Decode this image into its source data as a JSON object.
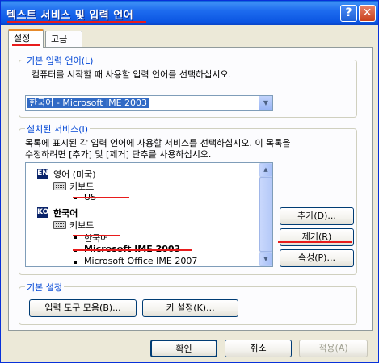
{
  "window": {
    "title": "텍스트 서비스 및 입력 언어",
    "help_glyph": "?",
    "close_glyph": "✕"
  },
  "tabs": [
    {
      "label": "설정",
      "active": true
    },
    {
      "label": "고급",
      "active": false
    }
  ],
  "default_language": {
    "legend": "기본 입력 언어(L)",
    "description": "컴퓨터를 시작할 때 사용할 입력 언어를 선택하십시오.",
    "selected": "한국어 - Microsoft IME 2003"
  },
  "installed_services": {
    "legend": "설치된 서비스(I)",
    "description_line1": "목록에 표시된 각 입력 언어에 사용할 서비스를 선택하십시오. 이 목록을",
    "description_line2": "수정하려면 [추가] 및 [제거] 단추를 사용하십시오.",
    "items": {
      "en_badge": "EN",
      "en_language": "영어 (미국)",
      "en_keyboard": "키보드",
      "en_layout": "US",
      "ko_badge": "KO",
      "ko_language": "한국어",
      "ko_keyboard": "키보드",
      "ko_layout": "한국어",
      "ko_ime_2003": "Microsoft IME 2003",
      "ko_ime_2007": "Microsoft Office IME 2007"
    },
    "buttons": {
      "add": "추가(D)...",
      "remove": "제거(R)",
      "properties": "속성(P)..."
    }
  },
  "preferences": {
    "legend": "기본 설정",
    "language_bar_button": "입력 도구 모음(B)...",
    "key_settings_button": "키 설정(K)..."
  },
  "footer": {
    "ok": "확인",
    "cancel": "취소",
    "apply": "적용(A)"
  },
  "colors": {
    "title_bar": "#0b55e2",
    "annotation_red": "#e81c1c",
    "group_legend": "#0046d5",
    "selection": "#316ac5"
  }
}
